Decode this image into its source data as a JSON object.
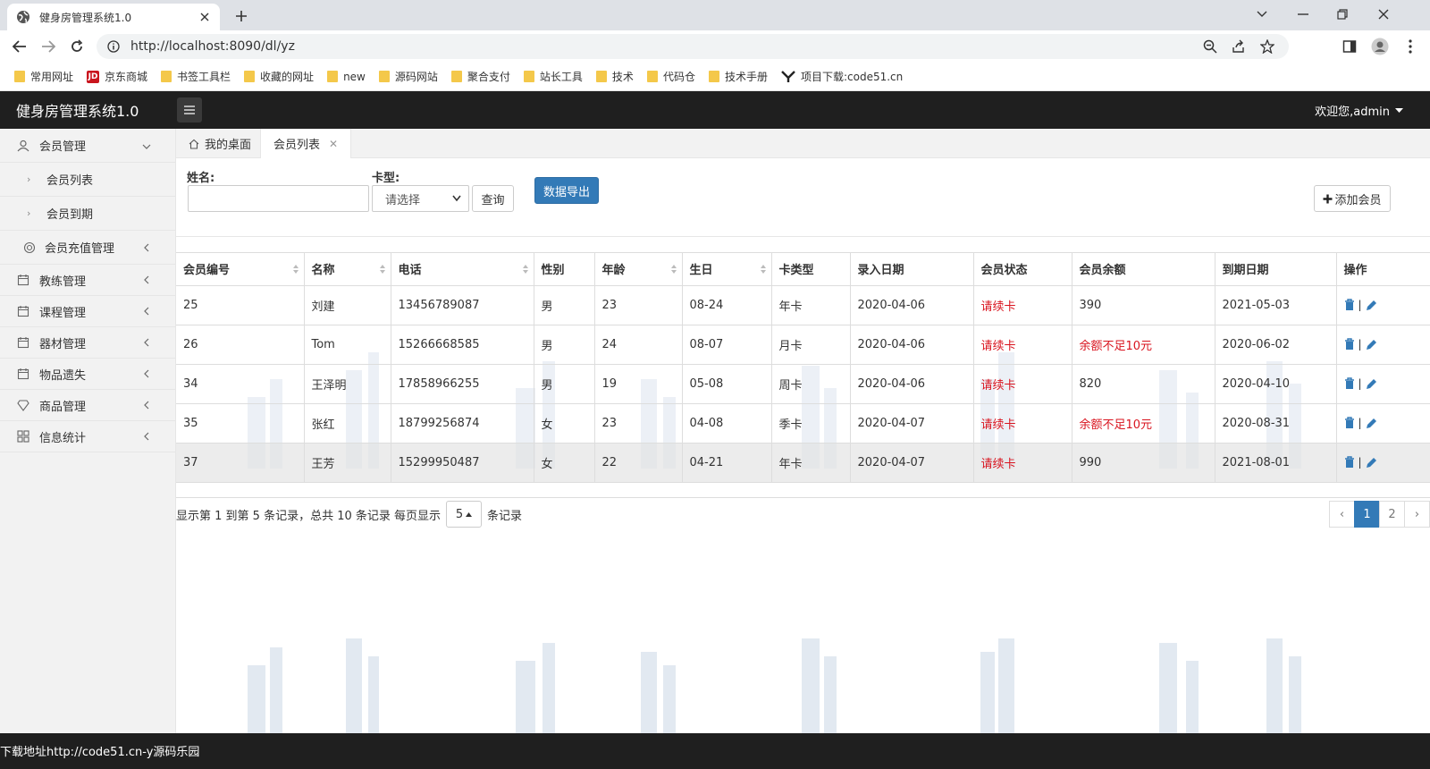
{
  "browser": {
    "tab_title": "健身房管理系统1.0",
    "url": "http://localhost:8090/dl/yz",
    "bookmarks": [
      "常用网址",
      "京东商城",
      "书签工具栏",
      "收藏的网址",
      "new",
      "源码网站",
      "聚合支付",
      "站长工具",
      "技术",
      "代码仓",
      "技术手册",
      "项目下载:code51.cn"
    ]
  },
  "app": {
    "title": "健身房管理系统1.0",
    "welcome": "欢迎您,admin"
  },
  "sidebar": {
    "member_mgmt": "会员管理",
    "member_list": "会员列表",
    "member_expire": "会员到期",
    "recharge_mgmt": "会员充值管理",
    "items": [
      "教练管理",
      "课程管理",
      "器材管理",
      "物品遗失",
      "商品管理",
      "信息统计"
    ]
  },
  "content_tabs": {
    "home": "我的桌面",
    "member_list": "会员列表"
  },
  "search": {
    "name_label": "姓名:",
    "card_label": "卡型:",
    "card_select": "请选择",
    "query_btn": "查询",
    "export_btn": "数据导出",
    "add_btn": "添加会员"
  },
  "table": {
    "headers": [
      "会员编号",
      "名称",
      "电话",
      "性别",
      "年龄",
      "生日",
      "卡类型",
      "录入日期",
      "会员状态",
      "会员余额",
      "到期日期",
      "操作"
    ],
    "rows": [
      [
        "25",
        "刘建",
        "13456789087",
        "男",
        "23",
        "08-24",
        "年卡",
        "2020-04-06",
        "请续卡",
        "390",
        "2021-05-03"
      ],
      [
        "26",
        "Tom",
        "15266668585",
        "男",
        "24",
        "08-07",
        "月卡",
        "2020-04-06",
        "请续卡",
        "余额不足10元",
        "2020-06-02"
      ],
      [
        "34",
        "王泽明",
        "17858966255",
        "男",
        "19",
        "05-08",
        "周卡",
        "2020-04-06",
        "请续卡",
        "820",
        "2020-04-10"
      ],
      [
        "35",
        "张红",
        "18799256874",
        "女",
        "23",
        "04-08",
        "季卡",
        "2020-04-07",
        "请续卡",
        "余额不足10元",
        "2020-08-31"
      ],
      [
        "37",
        "王芳",
        "15299950487",
        "女",
        "22",
        "04-21",
        "年卡",
        "2020-04-07",
        "请续卡",
        "990",
        "2021-08-01"
      ]
    ],
    "op_sep": "|"
  },
  "pager": {
    "info_prefix": "显示第 1 到第 5 条记录，总共 10 条记录 每页显示",
    "page_size": "5",
    "info_suffix": "条记录",
    "prev": "‹",
    "pages": [
      "1",
      "2"
    ],
    "next": "›"
  },
  "status_bar": "下载地址http://code51.cn-y源码乐园",
  "colors": {
    "header_bg": "#1f1f1f",
    "primary": "#337ab7",
    "alert_red": "#d9141f"
  }
}
